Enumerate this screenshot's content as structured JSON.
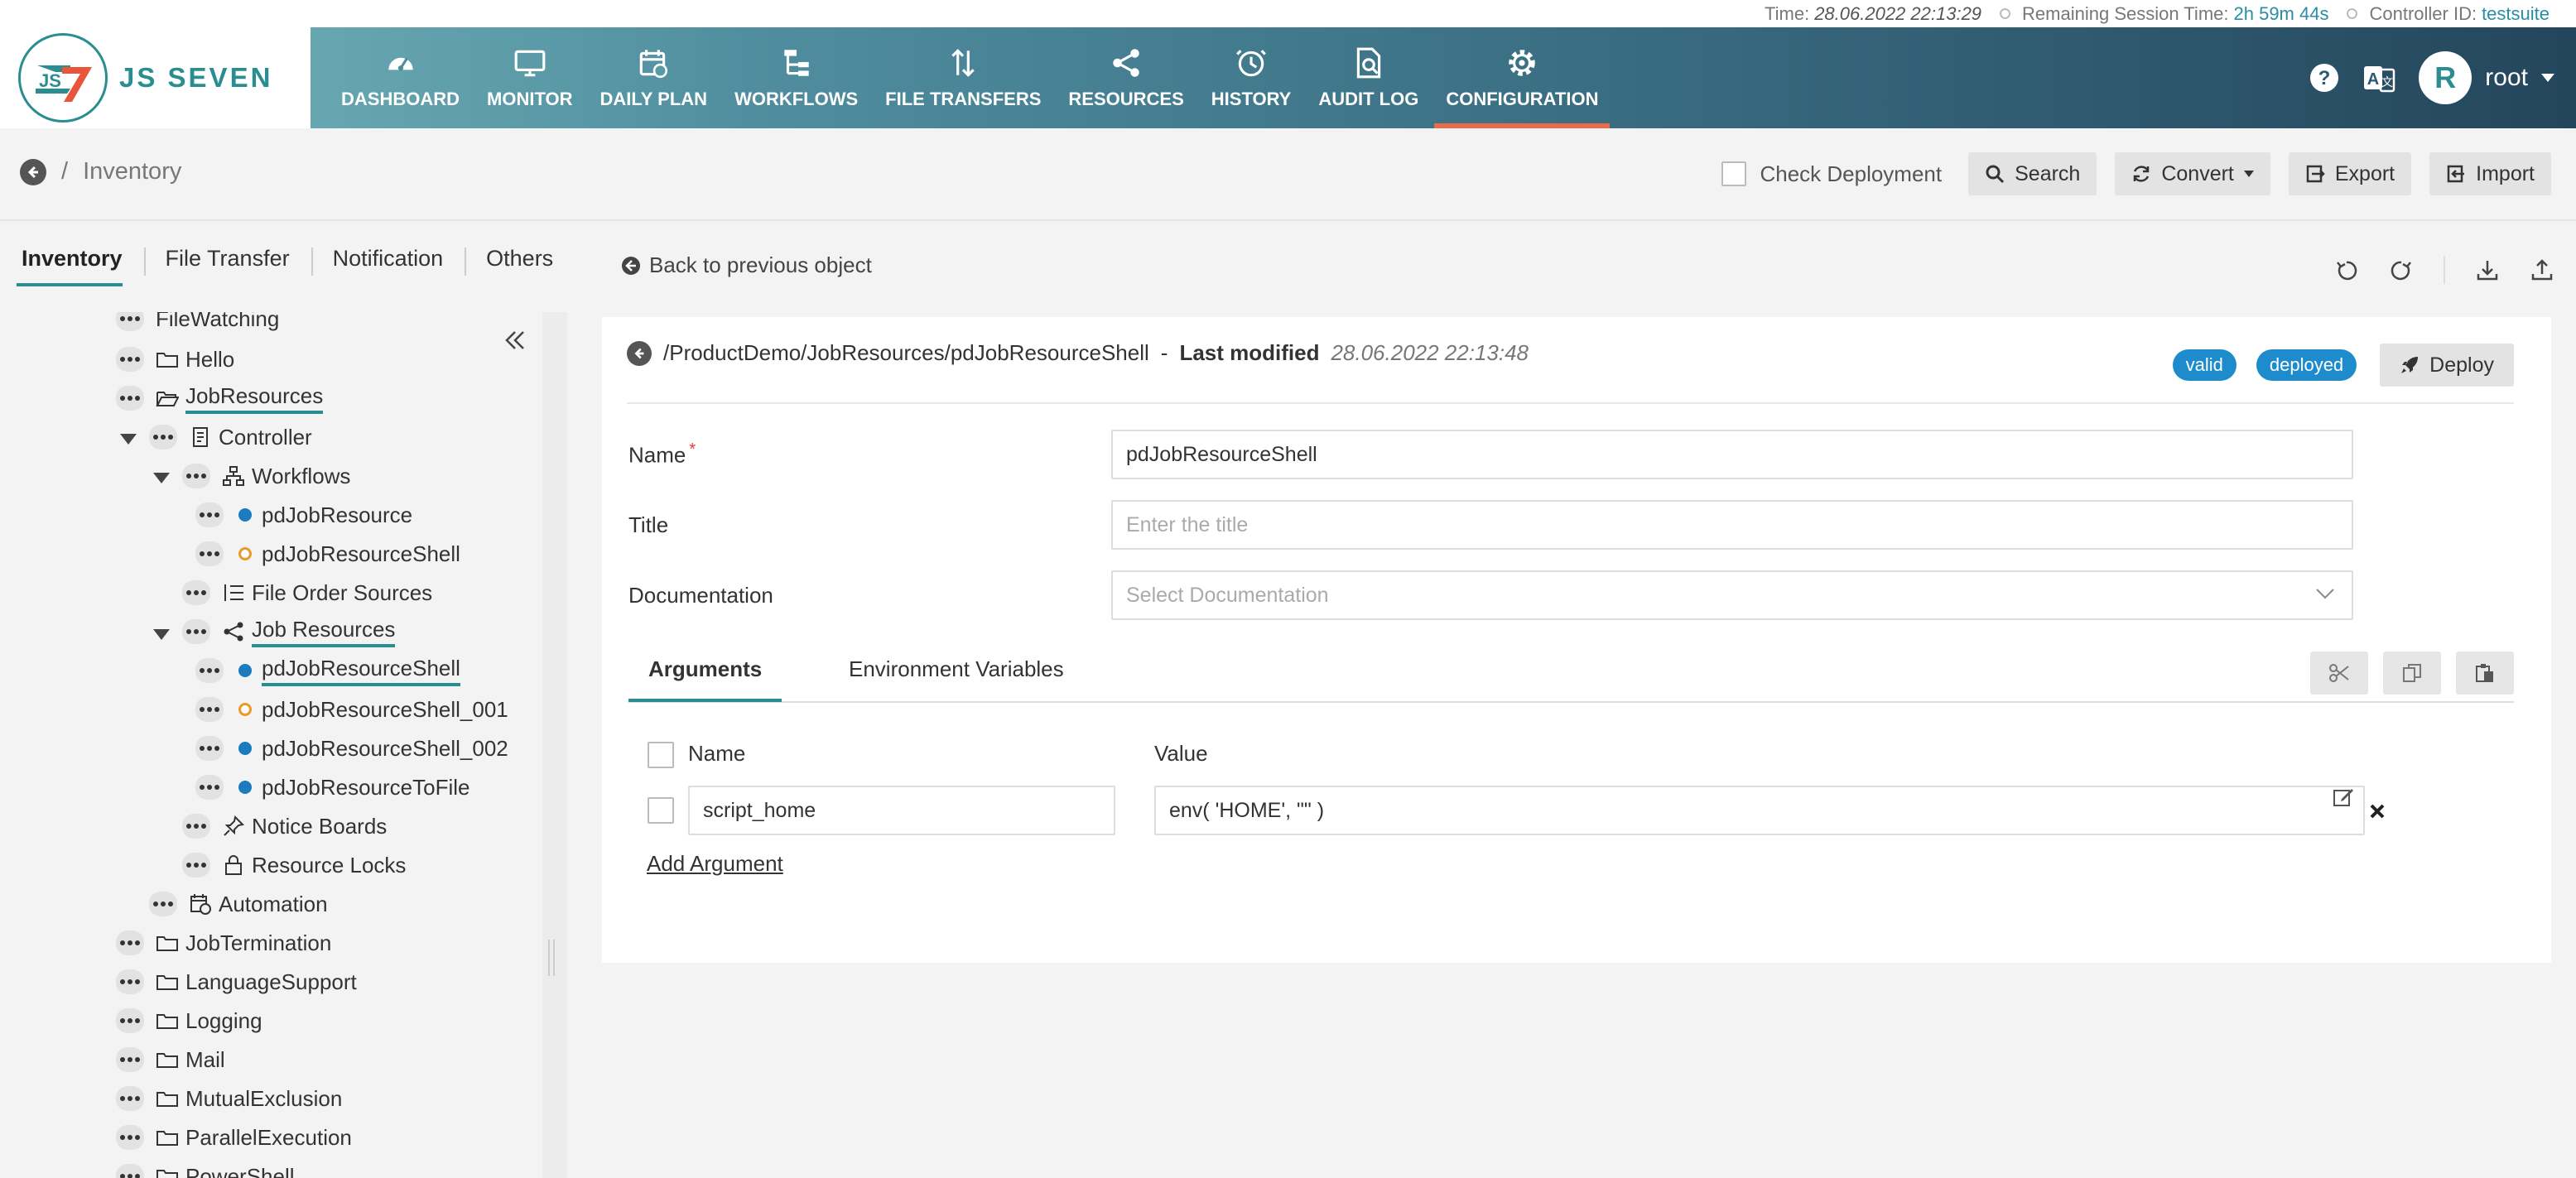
{
  "status": {
    "time_label": "Time:",
    "time_value": "28.06.2022 22:13:29",
    "remaining_label": "Remaining Session Time:",
    "remaining_value": "2h 59m 44s",
    "controller_label": "Controller ID:",
    "controller_value": "testsuite"
  },
  "brand": {
    "logo_mark": "JS7",
    "logo_text": "JS SEVEN"
  },
  "nav": {
    "items": [
      {
        "label": "DASHBOARD",
        "icon": "dashboard-icon"
      },
      {
        "label": "MONITOR",
        "icon": "monitor-icon"
      },
      {
        "label": "DAILY PLAN",
        "icon": "calendar-icon"
      },
      {
        "label": "WORKFLOWS",
        "icon": "workflow-icon"
      },
      {
        "label": "FILE TRANSFERS",
        "icon": "transfer-icon"
      },
      {
        "label": "RESOURCES",
        "icon": "share-icon"
      },
      {
        "label": "HISTORY",
        "icon": "history-icon"
      },
      {
        "label": "AUDIT LOG",
        "icon": "audit-icon"
      },
      {
        "label": "CONFIGURATION",
        "icon": "gear-icon",
        "active": true
      }
    ],
    "user_initial": "R",
    "user_name": "root"
  },
  "subheader": {
    "breadcrumb_sep": "/",
    "breadcrumb_title": "Inventory",
    "check_deployment": "Check Deployment",
    "search": "Search",
    "convert": "Convert",
    "export": "Export",
    "import": "Import"
  },
  "tabs": {
    "items": [
      "Inventory",
      "File Transfer",
      "Notification",
      "Others"
    ],
    "active": "Inventory",
    "back_prev": "Back to previous object"
  },
  "tree": {
    "partial_top": "FileWatching",
    "hello": "Hello",
    "job_resources": "JobResources",
    "controller": "Controller",
    "workflows": "Workflows",
    "wf1": "pdJobResource",
    "wf2": "pdJobResourceShell",
    "file_order_sources": "File Order Sources",
    "job_resources_sub": "Job Resources",
    "jr1": "pdJobResourceShell",
    "jr2": "pdJobResourceShell_001",
    "jr3": "pdJobResourceShell_002",
    "jr4": "pdJobResourceToFile",
    "notice_boards": "Notice Boards",
    "resource_locks": "Resource Locks",
    "automation": "Automation",
    "job_termination": "JobTermination",
    "language_support": "LanguageSupport",
    "logging": "Logging",
    "mail": "Mail",
    "mutual_exclusion": "MutualExclusion",
    "parallel_execution": "ParallelExecution",
    "partial_bottom": "PowerShell"
  },
  "editor": {
    "path": "/ProductDemo/JobResources/pdJobResourceShell",
    "dash": "-",
    "last_modified_label": "Last modified",
    "last_modified_value": "28.06.2022 22:13:48",
    "badge_valid": "valid",
    "badge_deployed": "deployed",
    "deploy": "Deploy",
    "name_label": "Name",
    "required_mark": "*",
    "name_value": "pdJobResourceShell",
    "title_label": "Title",
    "title_placeholder": "Enter the title",
    "doc_label": "Documentation",
    "doc_placeholder": "Select Documentation",
    "tab_arguments": "Arguments",
    "tab_env": "Environment Variables",
    "col_name": "Name",
    "col_value": "Value",
    "arg_name": "script_home",
    "arg_value": "env( 'HOME', \"\" )",
    "add_argument": "Add Argument"
  },
  "colors": {
    "accent": "#2a8d8f",
    "nav_active_underline": "#e86b4a",
    "badge": "#1e8ccc",
    "bullet_blue": "#1c7bbf",
    "bullet_orange": "#e89b2b"
  }
}
